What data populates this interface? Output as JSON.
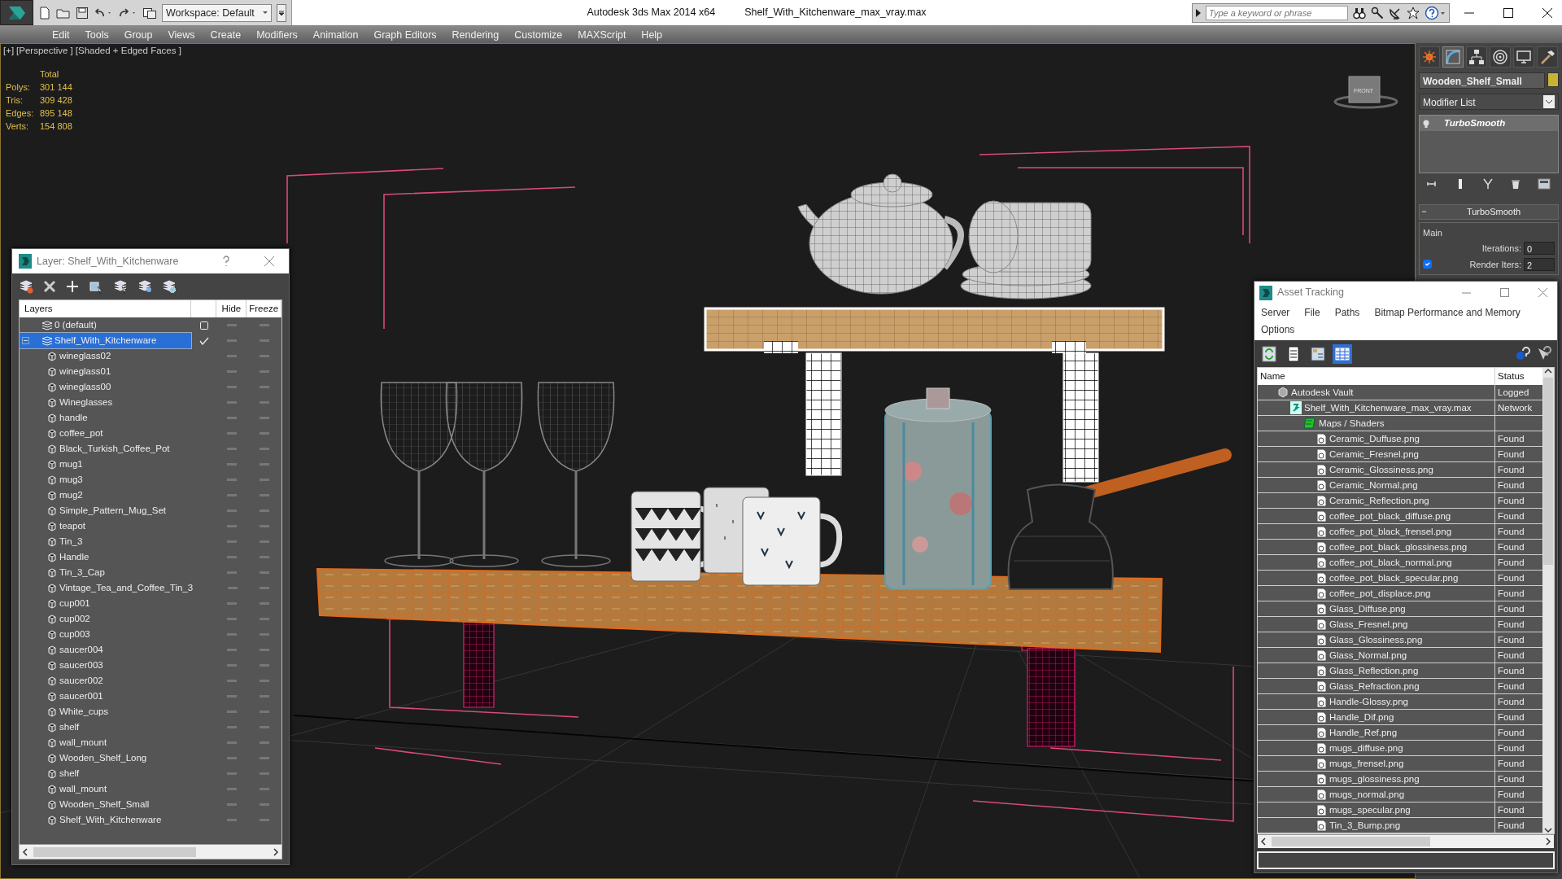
{
  "title_bar": {
    "workspace": "Workspace: Default",
    "app_title": "Autodesk 3ds Max  2014 x64",
    "file_name": "Shelf_With_Kitchenware_max_vray.max",
    "search": {
      "placeholder": "Type a keyword or phrase"
    }
  },
  "menu": [
    "Edit",
    "Tools",
    "Group",
    "Views",
    "Create",
    "Modifiers",
    "Animation",
    "Graph Editors",
    "Rendering",
    "Customize",
    "MAXScript",
    "Help"
  ],
  "viewport": {
    "labels": [
      "[+]",
      "[Perspective ]",
      "[Shaded + Edged Faces ]"
    ],
    "stats": {
      "heading": "Total",
      "rows": [
        {
          "label": "Polys:",
          "value": "301 144"
        },
        {
          "label": "Tris:",
          "value": "309 428"
        },
        {
          "label": "Edges:",
          "value": "895 148"
        },
        {
          "label": "Verts:",
          "value": "154 808"
        }
      ]
    },
    "viewcube_label": "FRONT"
  },
  "command_panel": {
    "tabs": [
      {
        "selected": false
      },
      {
        "selected": true
      },
      {
        "selected": false
      },
      {
        "selected": false
      },
      {
        "selected": false
      },
      {
        "selected": false
      }
    ],
    "object_name": "Wooden_Shelf_Small",
    "modifier_list": "Modifier List",
    "modifier_stack": [
      "TurboSmooth"
    ],
    "rollout": {
      "title": "TurboSmooth",
      "group": "Main",
      "iterations": {
        "label": "Iterations:",
        "value": "0"
      },
      "render_iters": {
        "label": "Render Iters:",
        "value": "2",
        "checked": true
      }
    }
  },
  "layer_dialog": {
    "title": "Layer: Shelf_With_Kitchenware",
    "columns": [
      "Layers",
      "Hide",
      "Freeze"
    ],
    "layers": [
      {
        "name": "0 (default)",
        "current": false,
        "selected": false,
        "expanded": false
      },
      {
        "name": "Shelf_With_Kitchenware",
        "current": true,
        "selected": true,
        "expanded": true,
        "children": [
          "wineglass02",
          "wineglass01",
          "wineglass00",
          "Wineglasses",
          "handle",
          "coffee_pot",
          "Black_Turkish_Coffee_Pot",
          "mug1",
          "mug3",
          "mug2",
          "Simple_Pattern_Mug_Set",
          "teapot",
          "Tin_3",
          "Handle",
          "Tin_3_Cap",
          "Vintage_Tea_and_Coffee_Tin_3",
          "cup001",
          "cup002",
          "cup003",
          "saucer004",
          "saucer003",
          "saucer002",
          "saucer001",
          "White_cups",
          "shelf",
          "wall_mount",
          "Wooden_Shelf_Long",
          "shelf",
          "wall_mount",
          "Wooden_Shelf_Small",
          "Shelf_With_Kitchenware"
        ]
      }
    ]
  },
  "asset_tracking": {
    "title": "Asset Tracking",
    "menu": [
      "Server",
      "File",
      "Paths",
      "Bitmap Performance and Memory",
      "Options"
    ],
    "toolbar": [
      {
        "selected": false
      },
      {
        "selected": false
      },
      {
        "selected": false
      },
      {
        "selected": true
      }
    ],
    "columns": [
      "Name",
      "Status"
    ],
    "tree": [
      {
        "name": "Autodesk Vault",
        "kind": "vault",
        "status": "Logged",
        "children": [
          {
            "name": "Shelf_With_Kitchenware_max_vray.max",
            "kind": "max-file",
            "status": "Network",
            "children": [
              {
                "name": "Maps / Shaders",
                "kind": "folder",
                "children": [
                  {
                    "name": "Ceramic_Duffuse.png",
                    "kind": "map",
                    "status": "Found"
                  },
                  {
                    "name": "Ceramic_Fresnel.png",
                    "kind": "map",
                    "status": "Found"
                  },
                  {
                    "name": "Ceramic_Glossiness.png",
                    "kind": "map",
                    "status": "Found"
                  },
                  {
                    "name": "Ceramic_Normal.png",
                    "kind": "map",
                    "status": "Found"
                  },
                  {
                    "name": "Ceramic_Reflection.png",
                    "kind": "map",
                    "status": "Found"
                  },
                  {
                    "name": "coffee_pot_black_diffuse.png",
                    "kind": "map",
                    "status": "Found"
                  },
                  {
                    "name": "coffee_pot_black_frensel.png",
                    "kind": "map",
                    "status": "Found"
                  },
                  {
                    "name": "coffee_pot_black_glossiness.png",
                    "kind": "map",
                    "status": "Found"
                  },
                  {
                    "name": "coffee_pot_black_normal.png",
                    "kind": "map",
                    "status": "Found"
                  },
                  {
                    "name": "coffee_pot_black_specular.png",
                    "kind": "map",
                    "status": "Found"
                  },
                  {
                    "name": "coffee_pot_displace.png",
                    "kind": "map",
                    "status": "Found"
                  },
                  {
                    "name": "Glass_Diffuse.png",
                    "kind": "map",
                    "status": "Found"
                  },
                  {
                    "name": "Glass_Fresnel.png",
                    "kind": "map",
                    "status": "Found"
                  },
                  {
                    "name": "Glass_Glossiness.png",
                    "kind": "map",
                    "status": "Found"
                  },
                  {
                    "name": "Glass_Normal.png",
                    "kind": "map",
                    "status": "Found"
                  },
                  {
                    "name": "Glass_Reflection.png",
                    "kind": "map",
                    "status": "Found"
                  },
                  {
                    "name": "Glass_Refraction.png",
                    "kind": "map",
                    "status": "Found"
                  },
                  {
                    "name": "Handle-Glossy.png",
                    "kind": "map",
                    "status": "Found"
                  },
                  {
                    "name": "Handle_Dif.png",
                    "kind": "map",
                    "status": "Found"
                  },
                  {
                    "name": "Handle_Ref.png",
                    "kind": "map",
                    "status": "Found"
                  },
                  {
                    "name": "mugs_diffuse.png",
                    "kind": "map",
                    "status": "Found"
                  },
                  {
                    "name": "mugs_frensel.png",
                    "kind": "map",
                    "status": "Found"
                  },
                  {
                    "name": "mugs_glossiness.png",
                    "kind": "map",
                    "status": "Found"
                  },
                  {
                    "name": "mugs_normal.png",
                    "kind": "map",
                    "status": "Found"
                  },
                  {
                    "name": "mugs_specular.png",
                    "kind": "map",
                    "status": "Found"
                  },
                  {
                    "name": "Tin_3_Bump.png",
                    "kind": "map",
                    "status": "Found"
                  }
                ]
              }
            ]
          }
        ]
      }
    ]
  }
}
